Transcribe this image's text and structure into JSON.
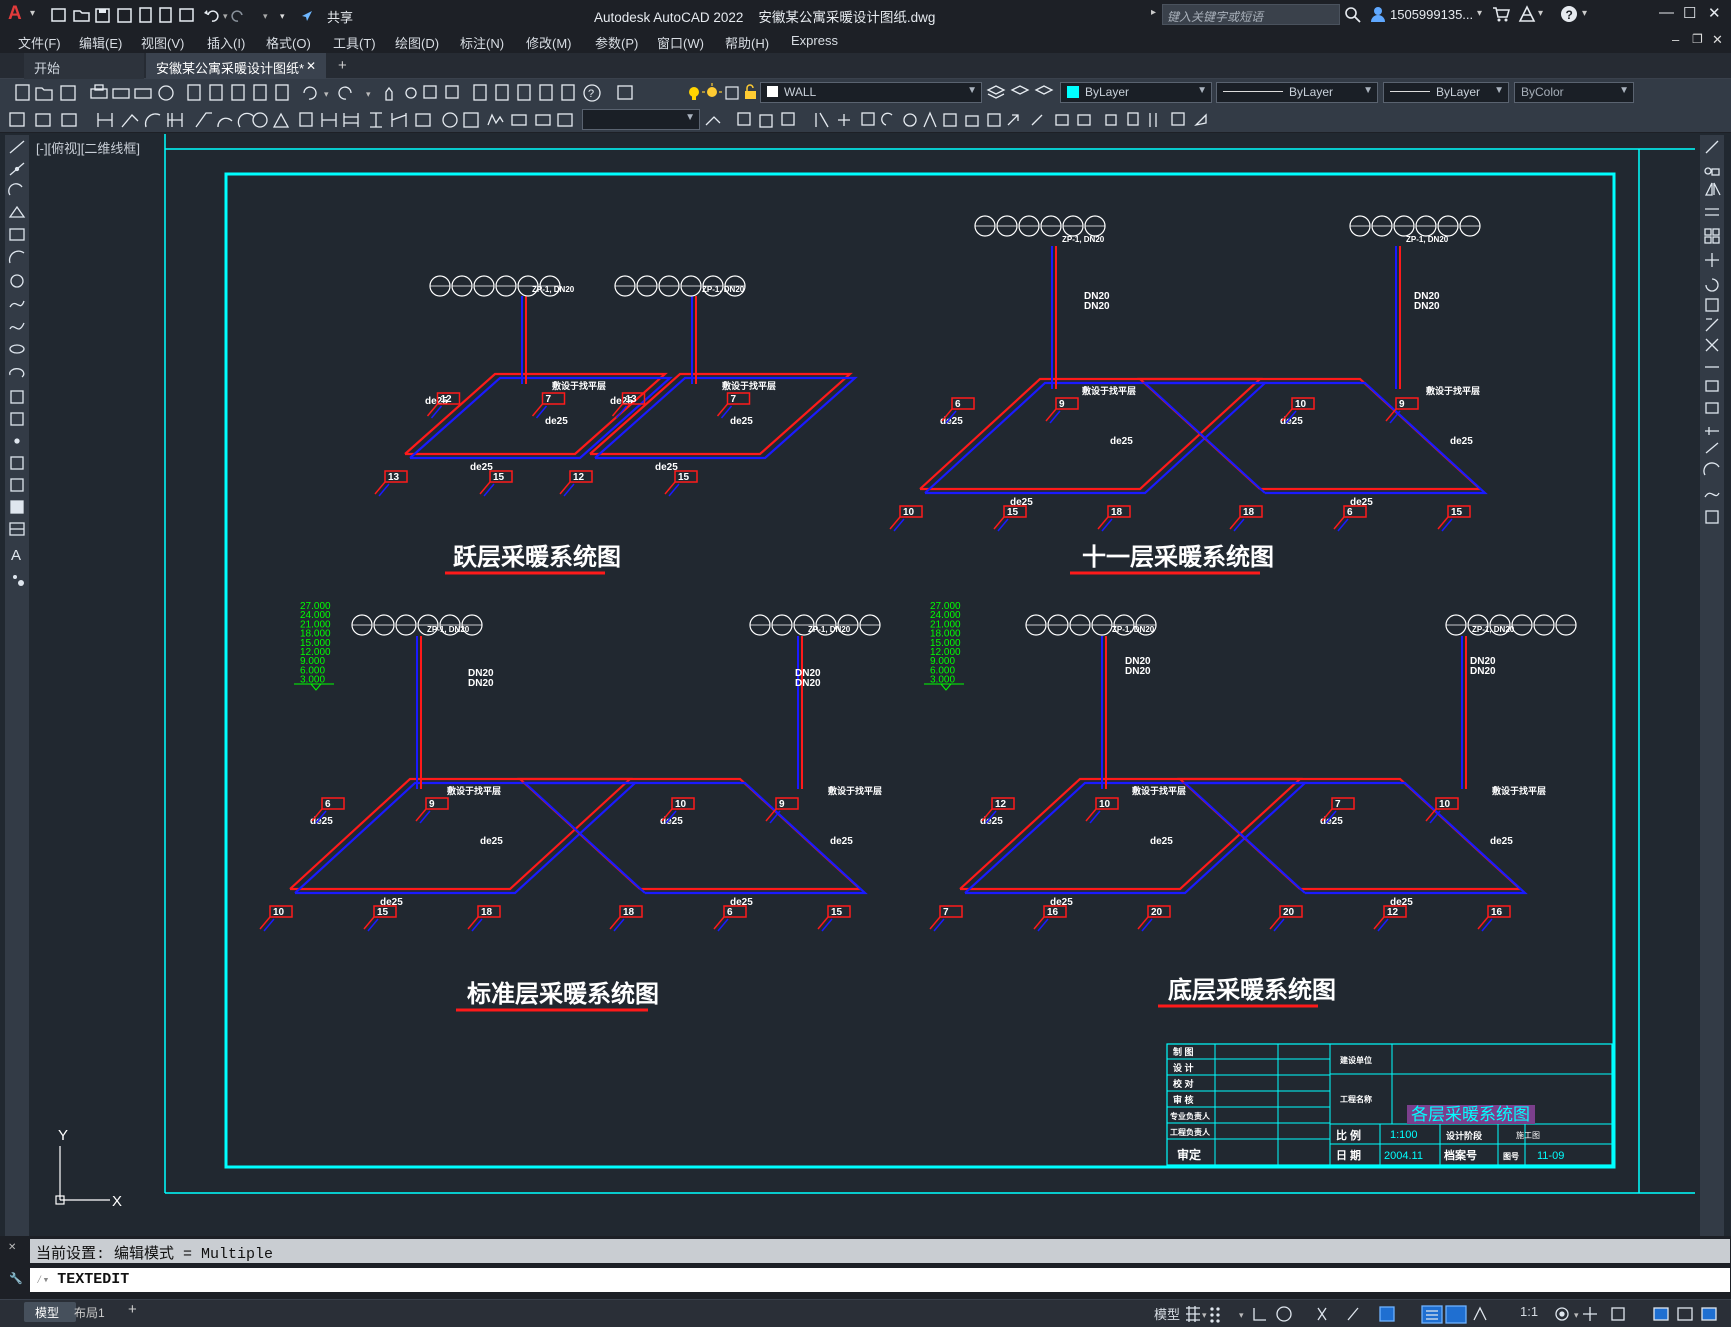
{
  "titlebar": {
    "app_logo": "A",
    "share": "共享",
    "title": "Autodesk AutoCAD 2022    安徽某公寓采暖设计图纸.dwg",
    "search_placeholder": "键入关键字或短语",
    "user": "1505999135...",
    "minimize": "—",
    "maximize": "☐",
    "close": "✕"
  },
  "menubar": {
    "items": [
      "文件(F)",
      "编辑(E)",
      "视图(V)",
      "插入(I)",
      "格式(O)",
      "工具(T)",
      "绘图(D)",
      "标注(N)",
      "修改(M)",
      "参数(P)",
      "窗口(W)",
      "帮助(H)",
      "Express"
    ]
  },
  "tabs": {
    "start": "开始",
    "doc": "安徽某公寓采暖设计图纸*",
    "close": "✕",
    "add": "+"
  },
  "toolbar": {
    "layer": "WALL",
    "color": "ByLayer",
    "linetype": "ByLayer",
    "lineweight": "ByLayer",
    "plotstyle": "ByColor"
  },
  "viewport": {
    "label": "[-][俯视][二维线框]"
  },
  "drawing": {
    "titles": {
      "top_left": "跃层采暖系统图",
      "top_right": "十一层采暖系统图",
      "bottom_left": "标准层采暖系统图",
      "bottom_right": "底层采暖系统图"
    },
    "pipe_label": "de25",
    "riser_label": "ZP-1, DN20",
    "dn_label": "DN20",
    "trench_label": "敷设于找平层",
    "radiator_numbers": [
      "13",
      "12",
      "15",
      "7",
      "10",
      "6",
      "18",
      "9",
      "20",
      "16"
    ],
    "elevations": [
      "27.000",
      "24.000",
      "21.000",
      "18.000",
      "15.000",
      "12.000",
      "9.000",
      "6.000",
      "3.000"
    ],
    "titleblock": {
      "rows_left": [
        "制 图",
        "设 计",
        "校 对",
        "审 核",
        "专业负责人",
        "工程负责人",
        "审定"
      ],
      "unit_label": "建设单位",
      "project_label": "工程名称",
      "drawing_title": "各层采暖系统图",
      "scale_label": "比 例",
      "scale": "1:100",
      "stage_label": "设计阶段",
      "stage": "施工图",
      "date_label": "日 期",
      "date": "2004.11",
      "archive_label": "档案号",
      "sheet_label": "图号",
      "sheet": "11-09"
    }
  },
  "ucs": {
    "x": "X",
    "y": "Y"
  },
  "command": {
    "history": "当前设置: 编辑模式 = Multiple",
    "current": "TEXTEDIT"
  },
  "statusbar": {
    "tabs": [
      "模型",
      "布局1"
    ],
    "add": "+",
    "model": "模型",
    "scale": "1:1"
  },
  "colors": {
    "cyan": "#00ffff",
    "red": "#ff1a1a",
    "blue": "#1a1aff",
    "green": "#00ff00",
    "bg": "#212830"
  }
}
